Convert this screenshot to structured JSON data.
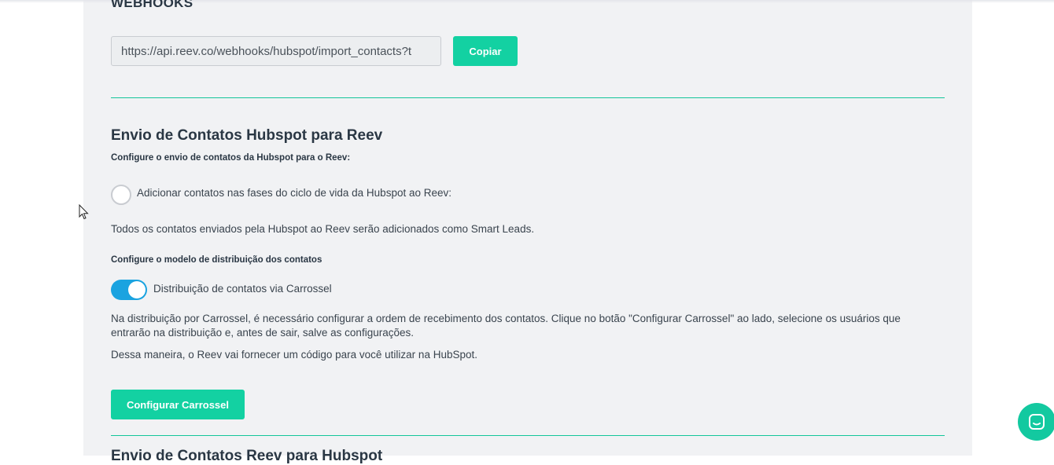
{
  "webhooks": {
    "title": "WEBHOOKS",
    "url_value": "https://api.reev.co/webhooks/hubspot/import_contacts?t",
    "copy_label": "Copiar"
  },
  "hubspot_to_reev": {
    "title": "Envio de Contatos Hubspot para Reev",
    "configure_label": "Configure o envio de contatos da Hubspot para o Reev:",
    "radio_label": "Adicionar contatos nas fases do ciclo de vida da Hubspot ao Reev:",
    "smart_leads_text": "Todos os contatos enviados pela Hubspot ao Reev serão adicionados como Smart Leads.",
    "distribution_label": "Configure o modelo de distribuição dos contatos",
    "toggle_label": "Distribuição de contatos via Carrossel",
    "toggle_on": true,
    "carousel_text_line1": "Na distribuição por Carrossel, é necessário configurar a ordem de recebimento dos contatos. Clique no botão \"Configurar Carrossel\" ao lado, selecione os usuários que",
    "carousel_text_line2": "entrarão na distribuição e, antes de sair, salve as configurações.",
    "code_text": "Dessa maneira, o Reev vai fornecer um código para você utilizar na HubSpot.",
    "configure_carousel_button": "Configurar Carrossel"
  },
  "next_section": {
    "title_partial": "Envio de Contatos Reev para Hubspot"
  },
  "colors": {
    "accent": "#13d1a2",
    "toggle": "#1aa3e0",
    "panel_bg": "#f1f2f4"
  },
  "icons": {
    "cursor": "mouse-pointer-icon",
    "chat": "chat-bubble-icon"
  }
}
